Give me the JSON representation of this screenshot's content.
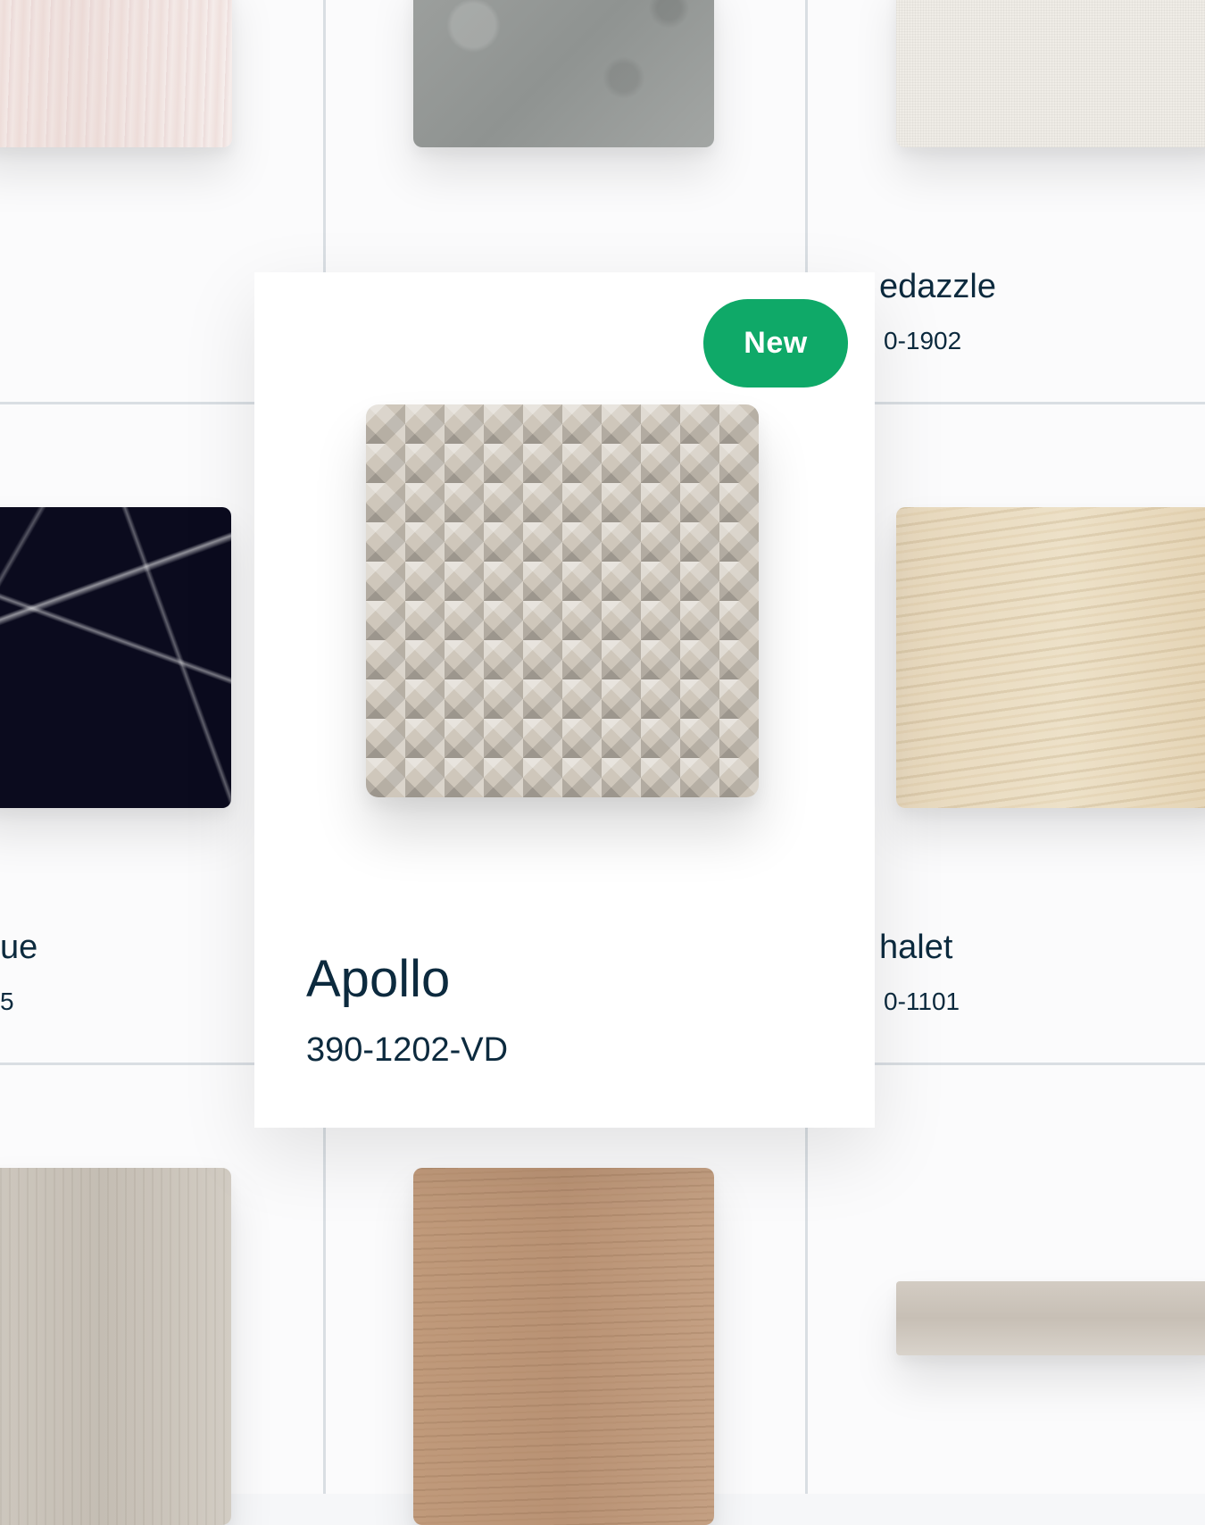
{
  "featured": {
    "badge": "New",
    "name": "Apollo",
    "code": "390-1202-VD"
  },
  "background_tiles": [
    {
      "name": "edazzle",
      "code": "0-1902"
    },
    {
      "name": "ue",
      "code": "5"
    },
    {
      "name": "halet",
      "code": "0-1101"
    }
  ],
  "colors": {
    "badge": "#0fa968",
    "text": "#0c2a3e",
    "grid_line": "#d9dee3"
  }
}
